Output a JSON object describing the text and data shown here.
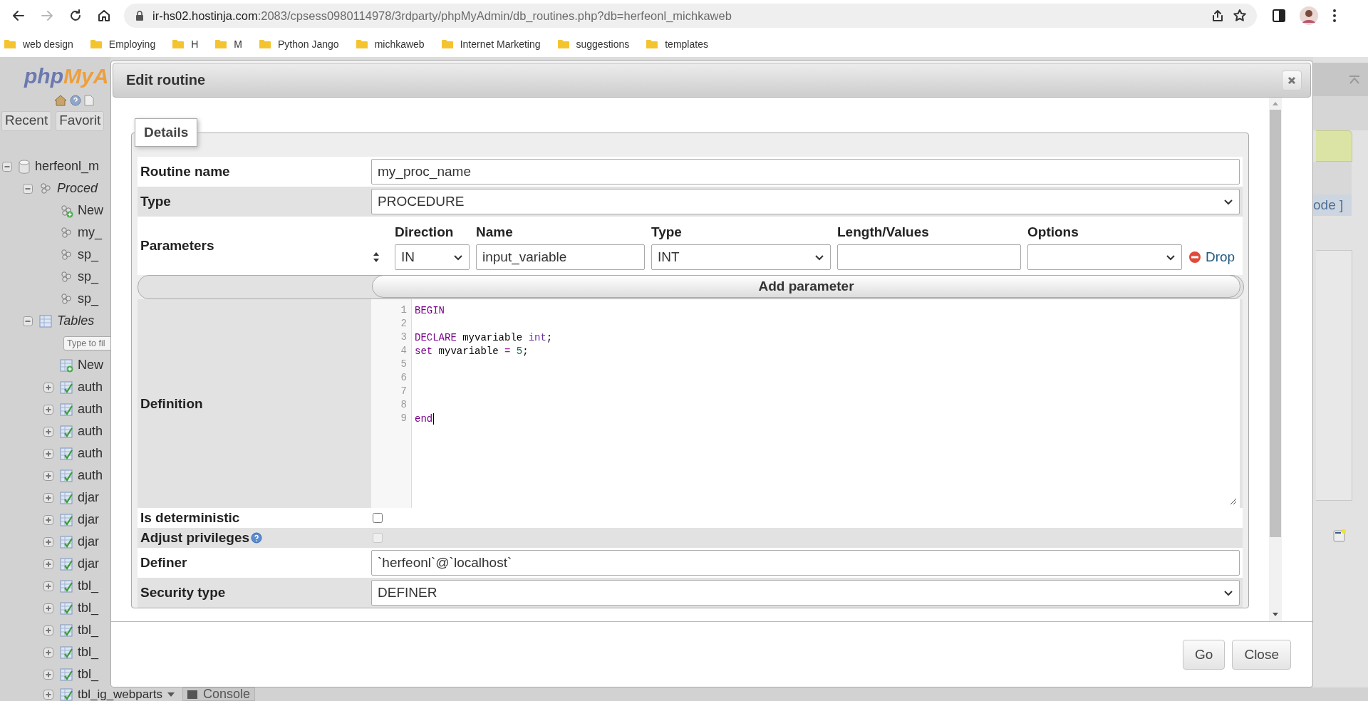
{
  "browser": {
    "forward_disabled": true,
    "url_host": "ir-hs02.hostinja.com",
    "url_rest": ":2083/cpsess0980114978/3rdparty/phpMyAdmin/db_routines.php?db=herfeonl_michkaweb",
    "bookmarks": [
      "web design",
      "Employing",
      "H",
      "M",
      "Python Jango",
      "michkaweb",
      "Internet Marketing",
      "suggestions",
      "templates"
    ]
  },
  "sidebar": {
    "logo": [
      "php",
      "MyA"
    ],
    "tabs": [
      "Recent",
      "Favorit"
    ],
    "tree": [
      {
        "kind": "database",
        "label": "herfeonl_m",
        "expanded": true,
        "children": [
          {
            "kind": "group",
            "label": "Proced",
            "expanded": true,
            "children": [
              {
                "kind": "new",
                "label": "New"
              },
              {
                "kind": "procedure",
                "label": "my_"
              },
              {
                "kind": "procedure",
                "label": "sp_"
              },
              {
                "kind": "procedure",
                "label": "sp_"
              },
              {
                "kind": "procedure",
                "label": "sp_"
              }
            ]
          },
          {
            "kind": "group",
            "label": "Tables",
            "expanded": true,
            "children": [
              {
                "kind": "filter",
                "placeholder": "Type to fil"
              },
              {
                "kind": "new-table",
                "label": "New"
              },
              {
                "kind": "table",
                "label": "auth",
                "expanded": false
              },
              {
                "kind": "table",
                "label": "auth",
                "expanded": false
              },
              {
                "kind": "table",
                "label": "auth",
                "expanded": false
              },
              {
                "kind": "table",
                "label": "auth",
                "expanded": false
              },
              {
                "kind": "table",
                "label": "auth",
                "expanded": false
              },
              {
                "kind": "table",
                "label": "djar",
                "expanded": false
              },
              {
                "kind": "table",
                "label": "djar",
                "expanded": false
              },
              {
                "kind": "table",
                "label": "djar",
                "expanded": false
              },
              {
                "kind": "table",
                "label": "djar",
                "expanded": false
              },
              {
                "kind": "table",
                "label": "tbl_",
                "expanded": false
              },
              {
                "kind": "table",
                "label": "tbl_",
                "expanded": false
              },
              {
                "kind": "table",
                "label": "tbl_",
                "expanded": false
              },
              {
                "kind": "table",
                "label": "tbl_",
                "expanded": false
              },
              {
                "kind": "table",
                "label": "tbl_",
                "expanded": false
              },
              {
                "kind": "table",
                "label": "tbl_ig_webparts",
                "expanded": false
              }
            ]
          }
        ]
      }
    ]
  },
  "right_panel": {
    "link": "ode ]"
  },
  "console": {
    "label": "Console"
  },
  "dialog": {
    "title": "Edit routine",
    "legend": "Details",
    "rows": [
      {
        "kind": "text",
        "label": "Routine name",
        "value": "my_proc_name"
      },
      {
        "kind": "select",
        "label": "Type",
        "value": "PROCEDURE"
      },
      {
        "kind": "params",
        "label": "Parameters",
        "columns": [
          "Direction",
          "Name",
          "Type",
          "Length/Values",
          "Options"
        ],
        "params": [
          {
            "direction": "IN",
            "name": "input_variable",
            "type": "INT",
            "drop": "Drop"
          }
        ],
        "add_button": "Add parameter"
      },
      {
        "kind": "code",
        "label": "Definition",
        "lines": [
          {
            "number": "1",
            "cursor": false,
            "tokens": [
              {
                "kind": "keyword",
                "text": "BEGIN"
              }
            ]
          },
          {
            "number": "2",
            "cursor": false
          },
          {
            "number": "3",
            "cursor": false,
            "tokens": [
              {
                "kind": "keyword",
                "text": "DECLARE"
              },
              {
                "kind": "plain",
                "text": " myvariable "
              },
              {
                "kind": "type",
                "text": "int"
              },
              {
                "kind": "plain",
                "text": ";"
              }
            ]
          },
          {
            "number": "4",
            "cursor": false,
            "tokens": [
              {
                "kind": "keyword",
                "text": "set"
              },
              {
                "kind": "plain",
                "text": " myvariable "
              },
              {
                "kind": "operator",
                "text": "= "
              },
              {
                "kind": "number",
                "text": "5"
              },
              {
                "kind": "plain",
                "text": ";"
              }
            ]
          },
          {
            "number": "5",
            "cursor": false
          },
          {
            "number": "6",
            "cursor": false
          },
          {
            "number": "7",
            "cursor": false
          },
          {
            "number": "8",
            "cursor": false
          },
          {
            "number": "9",
            "cursor": true,
            "tokens": [
              {
                "kind": "keyword",
                "text": "end"
              }
            ]
          }
        ]
      },
      {
        "kind": "checkbox",
        "label": "Is deterministic",
        "checked": false,
        "disabled": false,
        "help": false
      },
      {
        "kind": "checkbox",
        "label": "Adjust privileges",
        "checked": false,
        "disabled": true,
        "help": true
      },
      {
        "kind": "text",
        "label": "Definer",
        "value": "`herfeonl`@`localhost`"
      },
      {
        "kind": "select",
        "label": "Security type",
        "value": "DEFINER"
      }
    ],
    "buttons": [
      "Go",
      "Close"
    ]
  }
}
